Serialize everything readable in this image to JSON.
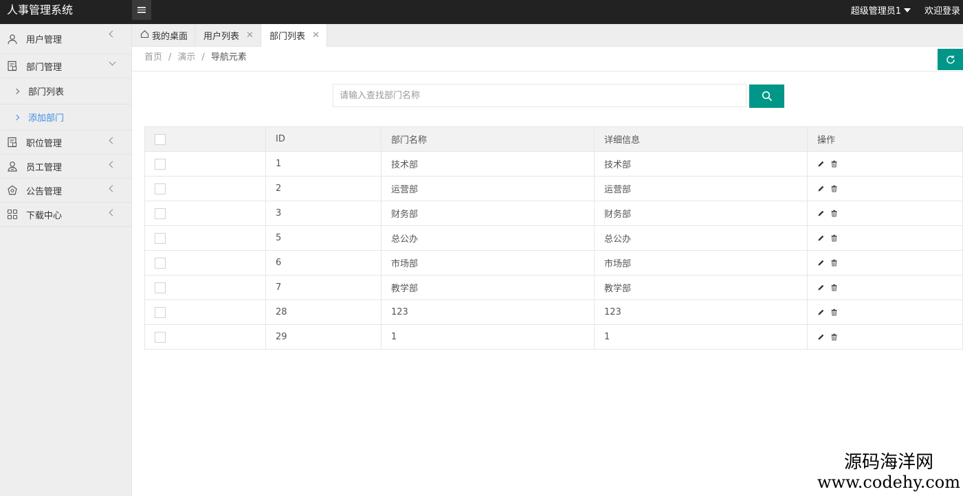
{
  "header": {
    "title": "人事管理系统",
    "admin_name": "超级管理员1",
    "login_label": "欢迎登录"
  },
  "sidebar": {
    "items": [
      {
        "label": "用户管理",
        "icon": "user-icon"
      },
      {
        "label": "部门管理",
        "icon": "doc-icon"
      },
      {
        "label": "职位管理",
        "icon": "doc-icon"
      },
      {
        "label": "员工管理",
        "icon": "staff-icon"
      },
      {
        "label": "公告管理",
        "icon": "bell-icon"
      },
      {
        "label": "下载中心",
        "icon": "grid-icon"
      }
    ],
    "sub_items": [
      {
        "label": "部门列表"
      },
      {
        "label": "添加部门"
      }
    ]
  },
  "tabs": [
    {
      "label": "我的桌面"
    },
    {
      "label": "用户列表"
    },
    {
      "label": "部门列表"
    }
  ],
  "breadcrumb": {
    "items": [
      "首页",
      "演示",
      "导航元素"
    ]
  },
  "search": {
    "placeholder": "请输入查找部门名称"
  },
  "table": {
    "headers": [
      "ID",
      "部门名称",
      "详细信息",
      "操作"
    ],
    "rows": [
      {
        "id": "1",
        "name": "技术部",
        "info": "技术部"
      },
      {
        "id": "2",
        "name": "运营部",
        "info": "运营部"
      },
      {
        "id": "3",
        "name": "财务部",
        "info": "财务部"
      },
      {
        "id": "5",
        "name": "总公办",
        "info": "总公办"
      },
      {
        "id": "6",
        "name": "市场部",
        "info": "市场部"
      },
      {
        "id": "7",
        "name": "教学部",
        "info": "教学部"
      },
      {
        "id": "28",
        "name": "123",
        "info": "123"
      },
      {
        "id": "29",
        "name": "1",
        "info": "1"
      }
    ]
  },
  "watermark": {
    "line1": "源码海洋网",
    "line2": "www.codehy.com"
  },
  "colors": {
    "accent": "#009688",
    "active_link": "#3d8ee0",
    "header_bg": "#222222"
  }
}
